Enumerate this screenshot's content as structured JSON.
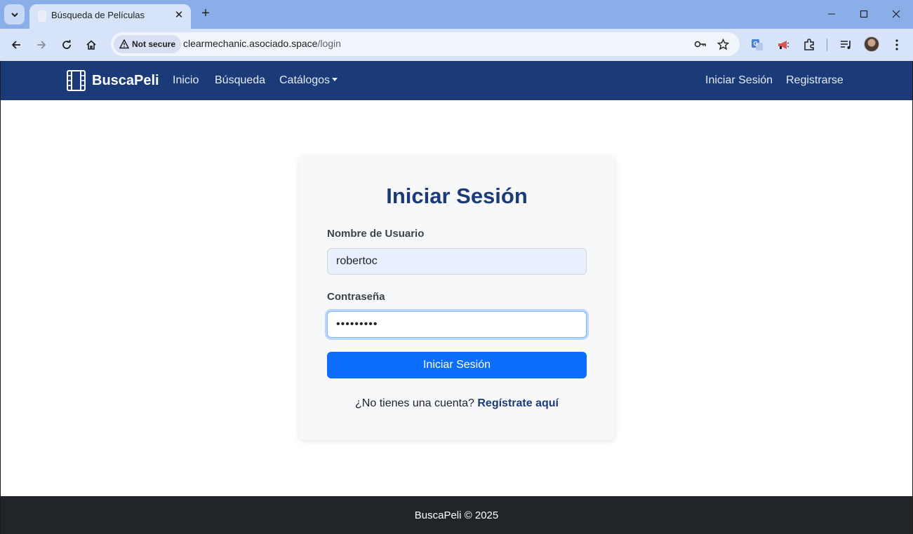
{
  "browser": {
    "tab_title": "Búsqueda de Películas",
    "not_secure_label": "Not secure",
    "url_host": "clearmechanic.asociado.space",
    "url_path": "/login",
    "icons": [
      "tab-search-icon",
      "close-icon",
      "new-tab-icon",
      "minimize-icon",
      "maximize-icon",
      "window-close-icon",
      "back-icon",
      "forward-icon",
      "reload-icon",
      "home-icon",
      "warning-icon",
      "key-icon",
      "star-icon",
      "translate-icon",
      "megaphone-icon",
      "extensions-icon",
      "media-icon",
      "menu-icon"
    ]
  },
  "navbar": {
    "brand": "BuscaPeli",
    "links": [
      "Inicio",
      "Búsqueda",
      "Catálogos"
    ],
    "right_links": [
      "Iniciar Sesión",
      "Registrarse"
    ],
    "background": "#1b3a78"
  },
  "login": {
    "title": "Iniciar Sesión",
    "username_label": "Nombre de Usuario",
    "username_value": "robertoc",
    "password_label": "Contraseña",
    "password_value": "•••••••••",
    "submit_label": "Iniciar Sesión",
    "signup_prompt": "¿No tienes una cuenta?",
    "signup_link": "Regístrate aquí",
    "button_color": "#0d6efd"
  },
  "footer": {
    "text": "BuscaPeli © 2025"
  }
}
